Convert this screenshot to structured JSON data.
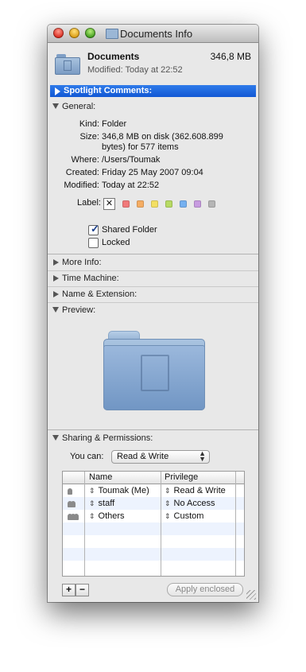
{
  "window": {
    "title": "Documents Info"
  },
  "header": {
    "name": "Documents",
    "size": "346,8 MB",
    "modified": "Modified: Today at 22:52"
  },
  "spotlight": {
    "label": "Spotlight Comments:"
  },
  "general": {
    "label": "General:",
    "kind_label": "Kind:",
    "kind": "Folder",
    "size_label": "Size:",
    "size_line1": "346,8 MB on disk (362.608.899",
    "size_line2": "bytes) for 577 items",
    "where_label": "Where:",
    "where": "/Users/Toumak",
    "created_label": "Created:",
    "created": "Friday 25 May 2007 09:04",
    "modified_label": "Modified:",
    "modified": "Today at 22:52",
    "label_label": "Label:",
    "label_clear": "✕",
    "label_colors": [
      "#f0797a",
      "#f5ad63",
      "#f3df62",
      "#b7da63",
      "#74b0f0",
      "#c79be0",
      "#b5b5b5"
    ],
    "shared_folder": "Shared Folder",
    "shared_checked": true,
    "locked": "Locked",
    "locked_checked": false
  },
  "sections": {
    "more_info": "More Info:",
    "time_machine": "Time Machine:",
    "name_ext": "Name & Extension:",
    "preview": "Preview:",
    "sharing": "Sharing & Permissions:"
  },
  "sharing": {
    "you_can_label": "You can:",
    "you_can_value": "Read & Write",
    "col_name": "Name",
    "col_privilege": "Privilege",
    "rows": [
      {
        "name": "Toumak (Me)",
        "privilege": "Read & Write"
      },
      {
        "name": "staff",
        "privilege": "No Access"
      },
      {
        "name": "Others",
        "privilege": "Custom"
      }
    ],
    "add_label": "+",
    "remove_label": "−",
    "apply_label": "Apply enclosed"
  }
}
